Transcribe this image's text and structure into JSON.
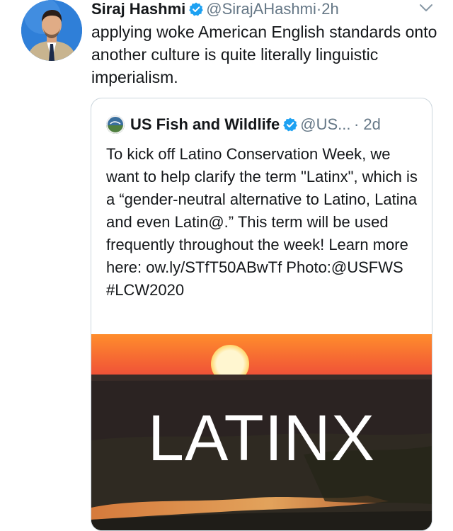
{
  "tweet": {
    "author_name": "Siraj Hashmi",
    "handle": "@SirajAHashmi",
    "separator": "·",
    "time": "2h",
    "text": "applying woke American English standards onto another culture is quite literally linguistic imperialism."
  },
  "quoted_tweet": {
    "author_name": "US Fish and Wildlife",
    "handle": "@US...",
    "time": "· 2d",
    "text": "To kick off Latino Conservation Week, we want to help clarify the term \"Latinx\", which is a “gender-neutral alternative to Latino, Latina and even Latin@.” This term will be used frequently throughout the week! Learn more here: ow.ly/STfT50ABwTf Photo:@USFWS #LCW2020",
    "media_text": "LATINX"
  },
  "colors": {
    "verified": "#1da1f2",
    "secondary_text": "#657786",
    "card_border": "#ccd6dd",
    "sky_top": "#ff8a2e",
    "sky_bottom": "#f0563a"
  },
  "icons": {
    "verified": "verified-badge-icon",
    "chevron": "chevron-down-icon"
  }
}
